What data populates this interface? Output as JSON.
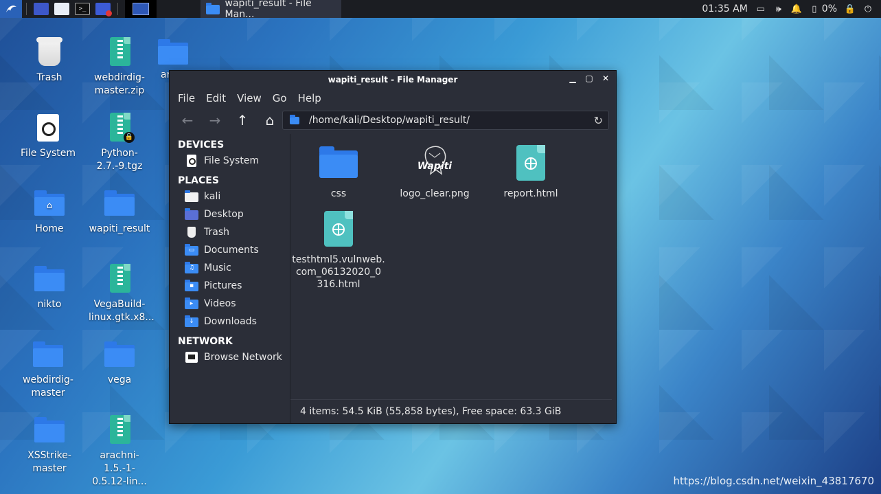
{
  "panel": {
    "task_label": "wapiti_result - File Man...",
    "clock": "01:35 AM",
    "battery": "0%"
  },
  "desktop": {
    "icons": [
      {
        "label": "Trash"
      },
      {
        "label": "webdirdig-master.zip"
      },
      {
        "label": "ar"
      },
      {
        "label": "File System"
      },
      {
        "label": "Python-2.7.-9.tgz"
      },
      {
        "label": "Home"
      },
      {
        "label": "wapiti_result"
      },
      {
        "label": "nikto"
      },
      {
        "label": "VegaBuild-linux.gtk.x8..."
      },
      {
        "label": "webdirdig-master"
      },
      {
        "label": "vega"
      },
      {
        "label": "XSStrike-master"
      },
      {
        "label": "arachni-1.5.-1-0.5.12-lin..."
      }
    ]
  },
  "window": {
    "title": "wapiti_result - File Manager",
    "menu": [
      "File",
      "Edit",
      "View",
      "Go",
      "Help"
    ],
    "path": "/home/kali/Desktop/wapiti_result/",
    "sidebar": {
      "devices_header": "DEVICES",
      "devices": [
        {
          "label": "File System"
        }
      ],
      "places_header": "PLACES",
      "places": [
        {
          "label": "kali"
        },
        {
          "label": "Desktop"
        },
        {
          "label": "Trash"
        },
        {
          "label": "Documents"
        },
        {
          "label": "Music"
        },
        {
          "label": "Pictures"
        },
        {
          "label": "Videos"
        },
        {
          "label": "Downloads"
        }
      ],
      "network_header": "NETWORK",
      "network": [
        {
          "label": "Browse Network"
        }
      ]
    },
    "files": [
      {
        "name": "css"
      },
      {
        "name": "logo_clear.png"
      },
      {
        "name": "report.html"
      },
      {
        "name": "testhtml5.vulnweb.com_06132020_0316.html",
        "display_lines": [
          "testhtml5.vulnweb.",
          "com_06132020_0",
          "316.html"
        ]
      }
    ],
    "logo_text": "Wapiti",
    "status": "4 items: 54.5 KiB (55,858 bytes), Free space: 63.3 GiB"
  },
  "watermark": "https://blog.csdn.net/weixin_43817670",
  "colors": {
    "folder": "#3b8cf5",
    "archive": "#2bb59a",
    "html_file": "#4fc1c0",
    "window_bg": "#2b2e38"
  }
}
